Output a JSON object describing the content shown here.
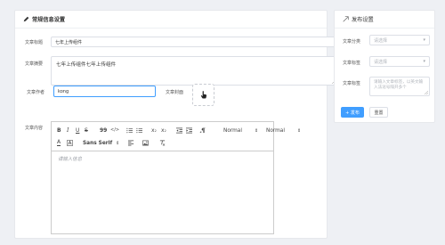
{
  "main_panel": {
    "title": "常规信息设置",
    "article_title": {
      "label": "文章标题",
      "value": "七年上传组件"
    },
    "article_summary": {
      "label": "文章摘要",
      "value": "七年上传组件七年上传组件"
    },
    "article_author": {
      "label": "文章作者",
      "value": "kong"
    },
    "article_cover": {
      "label": "文章封面"
    },
    "article_content": {
      "label": "文章内容",
      "placeholder": "请输入信息",
      "toolbar": {
        "bold": "B",
        "italic": "I",
        "underline": "U",
        "strike": "S",
        "quote": "99",
        "code": "</>",
        "subscript_base": "x",
        "subscript_sub": "2",
        "superscript_base": "x",
        "superscript_sup": "2",
        "header_select": "Normal",
        "size_select": "Normal",
        "font_select": "Sans Serif",
        "font_color": "A"
      }
    }
  },
  "publish_panel": {
    "title": "发布设置",
    "category": {
      "label": "文章分类",
      "placeholder": "请选择"
    },
    "tags": {
      "label": "文章标签",
      "placeholder": "请选择"
    },
    "keywords": {
      "label": "文章标签",
      "placeholder": "请输入文章标签，以英文输入法逗号隔开多个"
    },
    "publish_button": "+ 发布",
    "reset_button": "重置"
  },
  "colors": {
    "accent": "#409eff",
    "background": "#eef0f4",
    "border": "#dcdfe6"
  }
}
